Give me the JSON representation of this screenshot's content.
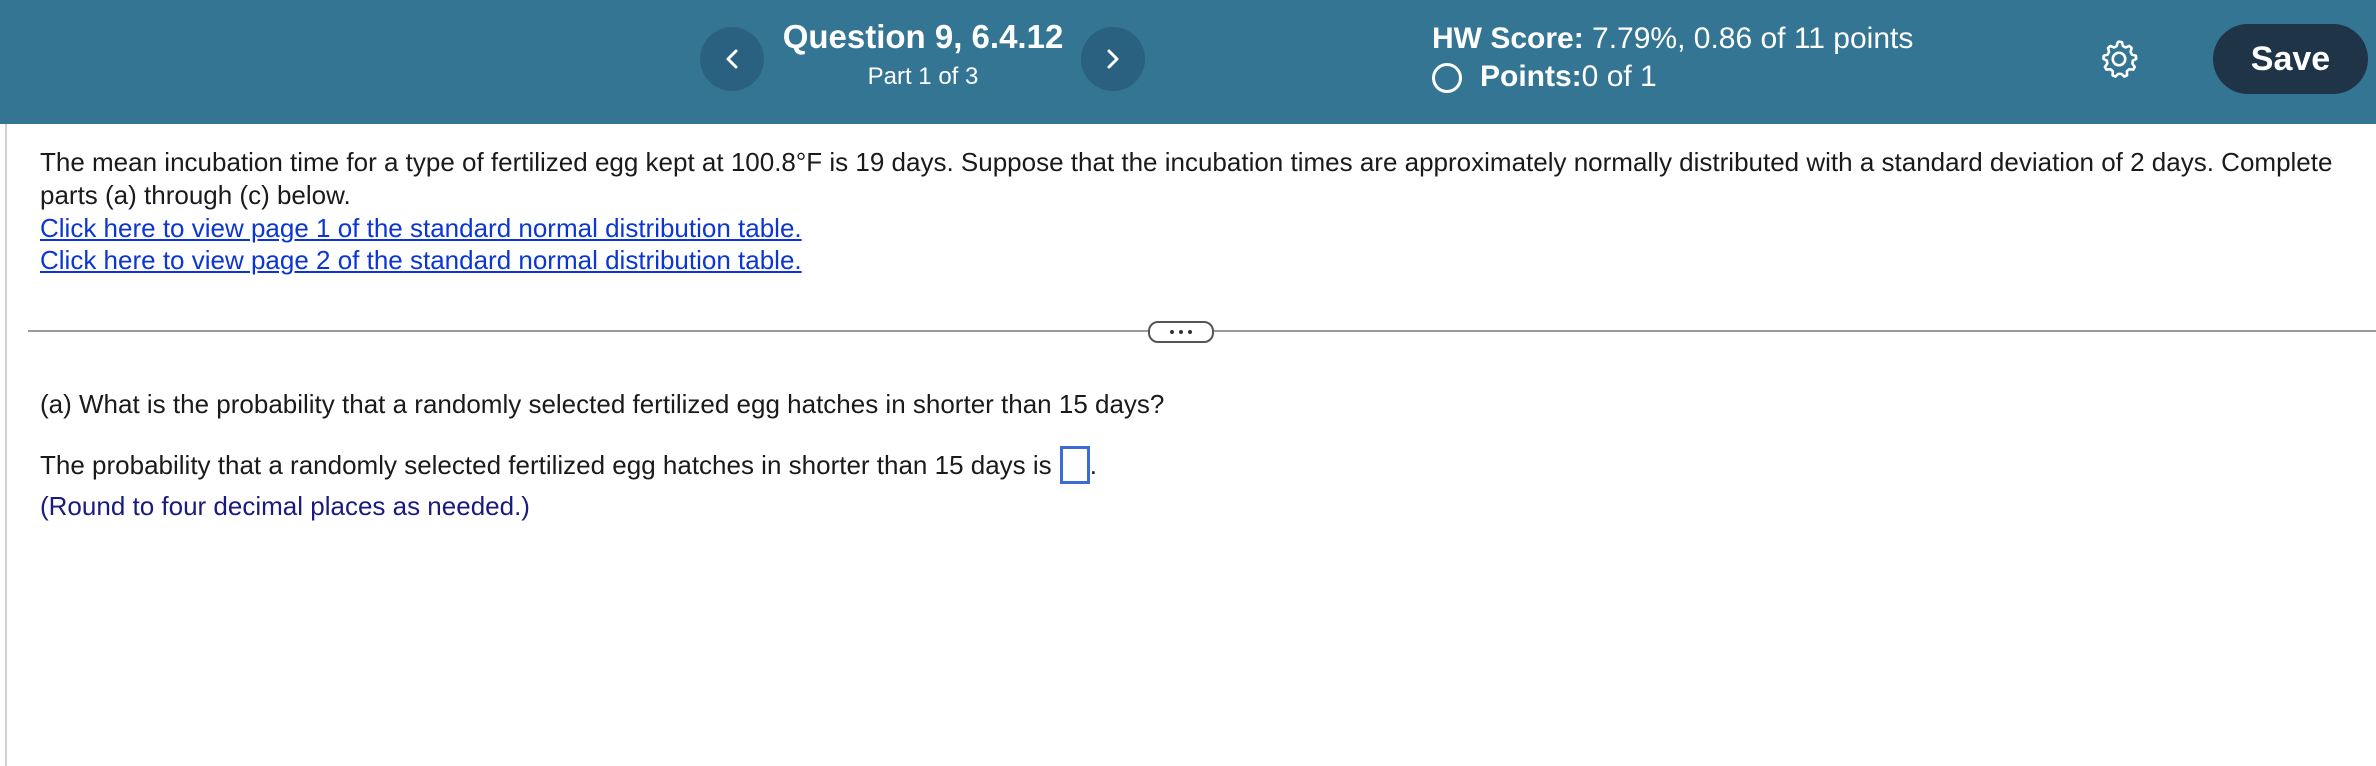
{
  "header": {
    "question_title": "Question 9, 6.4.12",
    "part_label": "Part 1 of 3",
    "prev_label": "‹",
    "next_label": "›",
    "hw_score_label": "HW Score:",
    "hw_score_value": " 7.79%, 0.86 of 11 points",
    "points_label": "Points:",
    "points_value": " 0 of 1",
    "save_label": "Save",
    "colors": {
      "bar": "#347594",
      "nav_button": "#2a6180",
      "save_button": "#1f3547"
    }
  },
  "problem": {
    "intro": "The mean incubation time for a type of fertilized egg kept at 100.8°F is 19 days. Suppose that the incubation times are approximately normally distributed with a standard deviation of 2 days. Complete parts (a) through (c) below.",
    "links": [
      "Click here to view page 1 of the standard normal distribution table.",
      "Click here to view page 2 of the standard normal distribution table."
    ]
  },
  "part_a": {
    "question": "(a) What is the probability that a randomly selected fertilized egg hatches in shorter than 15 days?",
    "answer_prefix": "The probability that a randomly selected fertilized egg hatches in shorter than 15 days is",
    "answer_suffix": ".",
    "answer_value": "",
    "hint": "(Round to four decimal places as needed.)"
  },
  "icons": {
    "prev": "chevron-left-icon",
    "next": "chevron-right-icon",
    "settings": "gear-icon",
    "points_status": "circle-outline-icon",
    "expander": "ellipsis-icon"
  }
}
